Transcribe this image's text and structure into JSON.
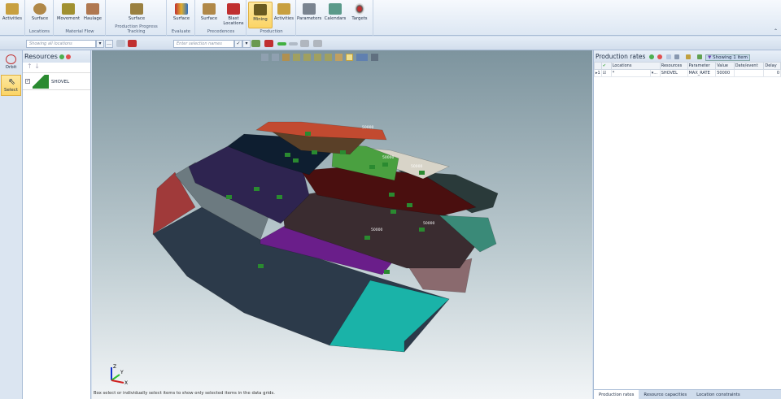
{
  "ribbon": {
    "groups": [
      {
        "caption": "",
        "buttons": [
          "Activities"
        ]
      },
      {
        "caption": "Locations",
        "buttons": [
          "Surface"
        ]
      },
      {
        "caption": "Material Flow",
        "buttons": [
          "Movement",
          "Haulage"
        ]
      },
      {
        "caption": "Production Progress Tracking",
        "buttons": [
          "Surface"
        ]
      },
      {
        "caption": "Evaluate",
        "buttons": [
          "Surface"
        ]
      },
      {
        "caption": "Precedences",
        "buttons": [
          "Surface",
          "Blast Locations"
        ]
      },
      {
        "caption": "Production",
        "buttons": [
          "Mining",
          "Activities"
        ]
      },
      {
        "caption": "",
        "buttons": [
          "Parameters",
          "Calendars",
          "Targets"
        ]
      }
    ],
    "active_button": "Mining"
  },
  "toolbar": {
    "locations_filter_placeholder": "Showing all locations",
    "selection_placeholder": "Enter selection names"
  },
  "tools": {
    "orbit": "Orbit",
    "select": "Select"
  },
  "resources": {
    "title": "Resources",
    "items": [
      {
        "name": "SHOVEL",
        "checked": true
      }
    ]
  },
  "viewport": {
    "labels": [
      "50000",
      "50000",
      "50000",
      "50000",
      "50000"
    ],
    "axes": {
      "x": "X",
      "y": "Y",
      "z": "Z"
    },
    "status": "Box select or individually select items to show only selected items in the data grids."
  },
  "production_rates": {
    "title": "Production rates",
    "filter_status": "Showing 1 item",
    "columns": [
      "Locations",
      "Resources",
      "Parameter",
      "Value",
      "Date/event",
      "Delay"
    ],
    "rows": [
      {
        "index": "1",
        "checked": true,
        "location": "*",
        "resource": "SHOVEL",
        "parameter": "MAX_RATE",
        "value": "50000",
        "date_event": "",
        "delay": "0"
      }
    ]
  },
  "tabs": [
    "Production rates",
    "Resource capacities",
    "Location constraints"
  ],
  "colors": {
    "accent": "#fbd465",
    "panel": "#d7e2ef"
  }
}
